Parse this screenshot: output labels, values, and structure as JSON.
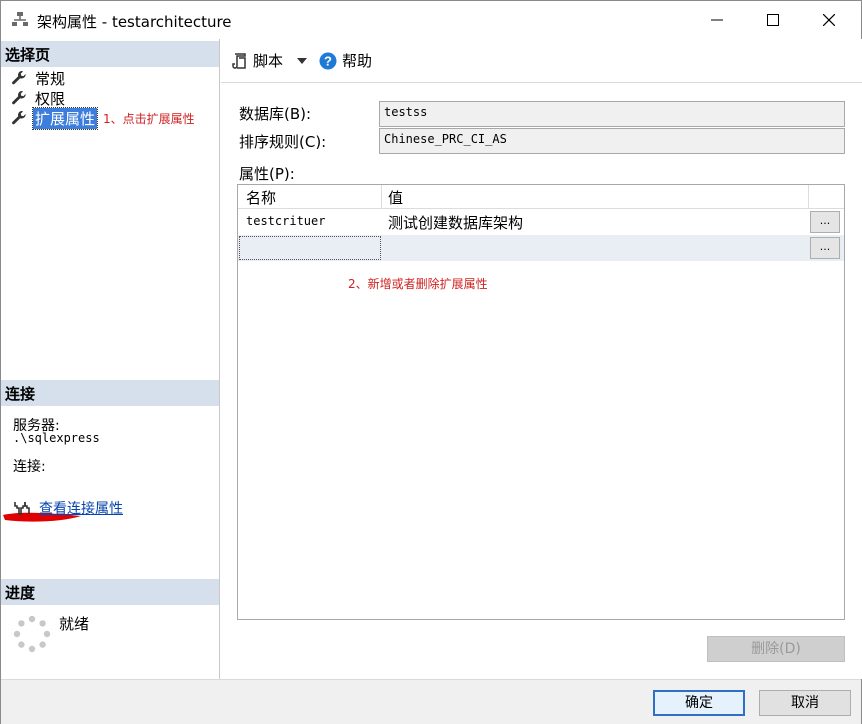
{
  "window": {
    "title": "架构属性 - testarchitecture",
    "controls": {
      "minimize": "minimize-icon",
      "maximize": "maximize-icon",
      "close": "close-icon"
    }
  },
  "left": {
    "select_page_header": "选择页",
    "pages": [
      {
        "label": "常规",
        "icon": "wrench-icon",
        "selected": false
      },
      {
        "label": "权限",
        "icon": "wrench-icon",
        "selected": false
      },
      {
        "label": "扩展属性",
        "icon": "wrench-icon",
        "selected": true
      }
    ],
    "annotation_1": "1、点击扩展属性",
    "connection_header": "连接",
    "server_label": "服务器:",
    "server_value": ".\\sqlexpress",
    "connection_label": "连接:",
    "view_conn_props_link": "查看连接属性",
    "progress_header": "进度",
    "progress_status": "就绪"
  },
  "toolbar": {
    "script_label": "脚本",
    "help_label": "帮助"
  },
  "form": {
    "database_label": "数据库(B):",
    "database_value": "testss",
    "collation_label": "排序规则(C):",
    "collation_value": "Chinese_PRC_CI_AS",
    "properties_label": "属性(P):"
  },
  "grid": {
    "col_name": "名称",
    "col_value": "值",
    "rows": [
      {
        "name": "testcrituer",
        "value": "测试创建数据库架构",
        "ellipsis": "..."
      }
    ],
    "new_row_ellipsis": "...",
    "annotation_2": "2、新增或者删除扩展属性"
  },
  "buttons": {
    "delete": "删除(D)",
    "ok": "确定",
    "cancel": "取消"
  },
  "colors": {
    "accent": "#3d7ddc",
    "section_header": "#d5e0ec",
    "annotation": "#d02020",
    "link": "#0645ad"
  }
}
